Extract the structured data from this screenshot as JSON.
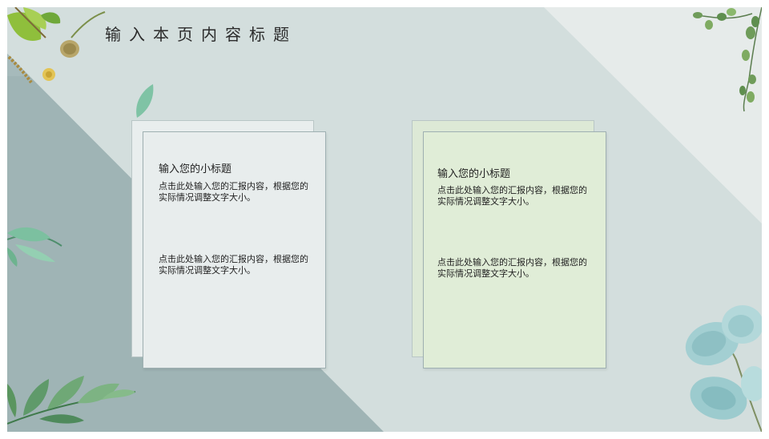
{
  "slide": {
    "title": "输入本页内容标题",
    "cards": [
      {
        "subtitle": "输入您的小标题",
        "para1": "点击此处输入您的汇报内容，根据您的实际情况调整文字大小。",
        "para2": "点击此处输入您的汇报内容，根据您的实际情况调整文字大小。"
      },
      {
        "subtitle": "输入您的小标题",
        "para1": "点击此处输入您的汇报内容，根据您的实际情况调整文字大小。",
        "para2": "点击此处输入您的汇报内容，根据您的实际情况调整文字大小。"
      }
    ]
  },
  "colors": {
    "background_light": "#d3dedd",
    "background_dark": "#9fb4b5",
    "card_left": "#e8eded",
    "card_right": "#e0edd7",
    "leaf_green": "#5f9a6a"
  },
  "decorations": [
    "leaf-cluster-icon",
    "eucalyptus-icon",
    "seed-pod-icon",
    "fern-branch-icon",
    "vine-icon"
  ]
}
